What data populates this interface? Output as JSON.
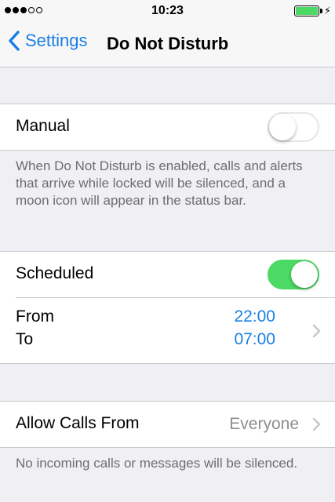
{
  "status": {
    "time": "10:23"
  },
  "nav": {
    "back_label": "Settings",
    "title": "Do Not Disturb"
  },
  "manual": {
    "label": "Manual",
    "enabled": false
  },
  "manual_footer": "When Do Not Disturb is enabled, calls and alerts that arrive while locked will be silenced, and a moon icon will appear in the status bar.",
  "scheduled": {
    "label": "Scheduled",
    "enabled": true
  },
  "schedule": {
    "from_label": "From",
    "from_value": "22:00",
    "to_label": "To",
    "to_value": "07:00"
  },
  "allow_calls": {
    "label": "Allow Calls From",
    "value": "Everyone"
  },
  "allow_calls_footer": "No incoming calls or messages will be silenced.",
  "colors": {
    "accent": "#1a7fe3",
    "toggle_on": "#4cd964",
    "background": "#efeff4"
  }
}
